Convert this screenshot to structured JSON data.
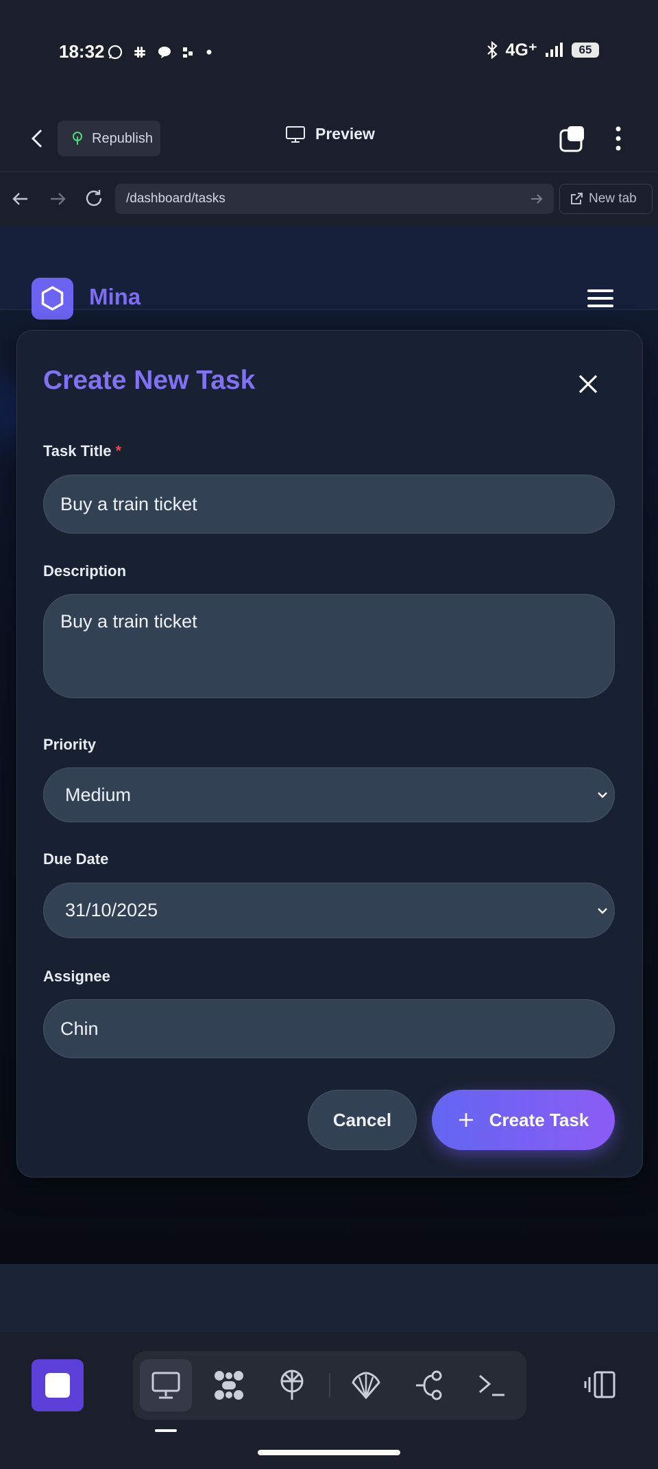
{
  "status_bar": {
    "time": "18:32",
    "network": "4G⁺",
    "battery": "65"
  },
  "app_bar": {
    "republish_label": "Republish",
    "preview_label": "Preview"
  },
  "browser": {
    "url": "/dashboard/tasks",
    "new_tab_label": "New tab"
  },
  "site": {
    "name": "Mina"
  },
  "modal": {
    "title": "Create New Task",
    "fields": {
      "title": {
        "label": "Task Title",
        "required_mark": "*",
        "value": "Buy a train ticket"
      },
      "description": {
        "label": "Description",
        "value": "Buy a train ticket"
      },
      "priority": {
        "label": "Priority",
        "value": "Medium"
      },
      "due_date": {
        "label": "Due Date",
        "value": "31/10/2025"
      },
      "assignee": {
        "label": "Assignee",
        "value": "Chin"
      }
    },
    "cancel_label": "Cancel",
    "create_label": "Create Task"
  },
  "colors": {
    "accent": "#6366f1",
    "accent_end": "#8b5cf6",
    "title": "#8172f3",
    "required": "#ef4444"
  }
}
